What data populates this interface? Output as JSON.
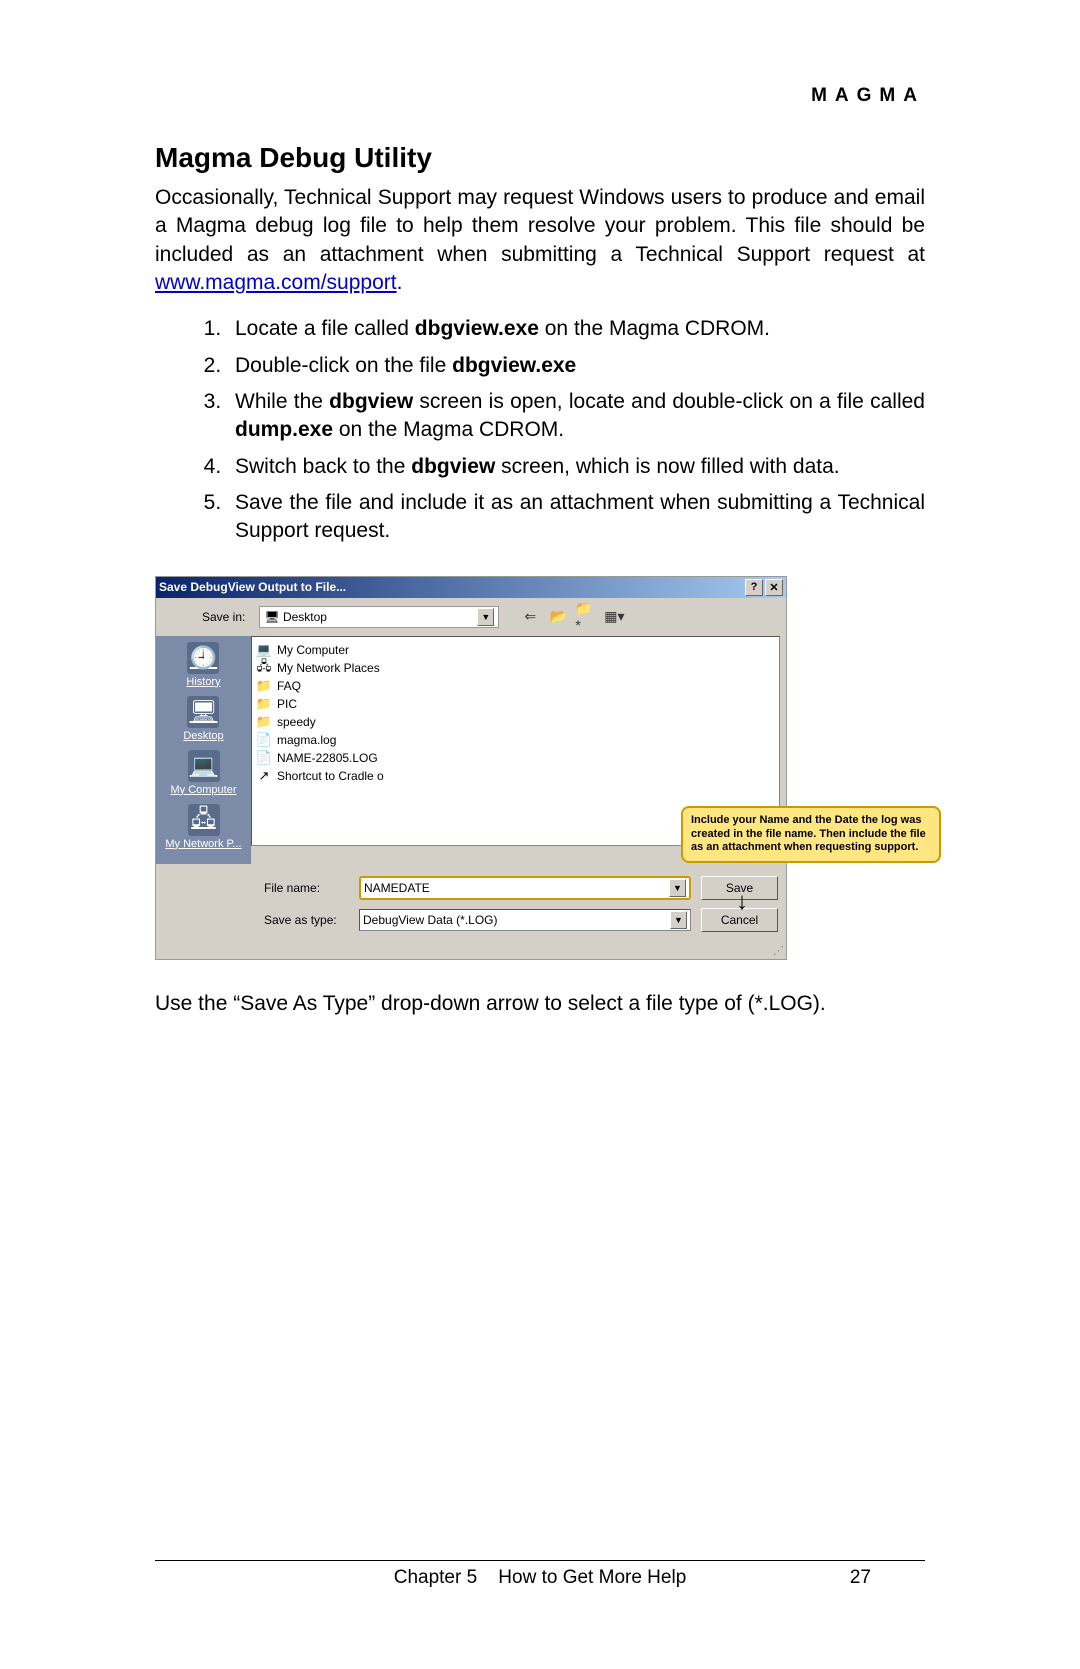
{
  "header": {
    "brand": "MAGMA"
  },
  "title": "Magma Debug Utility",
  "intro": {
    "part1": "Occasionally, Technical Support may request Windows users to produce and email a Magma debug log file to help them resolve your problem.  This file should be included as an attachment when submitting a Technical Support request at",
    "link": "www.magma.com/support",
    "part2": "."
  },
  "steps": [
    {
      "a": "Locate a file called",
      "b": "dbgview.exe",
      "c": "on the Magma CDROM."
    },
    {
      "a": "Double-click on the file",
      "b": "dbgview.exe"
    },
    {
      "a": "While the",
      "b": "dbgview",
      "c": "screen is open, locate and double-click on a file called",
      "d": "dump.exe",
      "e": "on the Magma CDROM."
    },
    {
      "a": "Switch back to the",
      "b": "dbgview",
      "c": "screen, which is now filled with data."
    },
    {
      "a": "Save the file and include it as an attachment when submitting a Technical Support request."
    }
  ],
  "dialog": {
    "title": "Save DebugView Output to File...",
    "help_btn": "?",
    "close_btn": "✕",
    "save_in_label": "Save in:",
    "save_in_value": "Desktop",
    "sidebar": [
      "History",
      "Desktop",
      "My Computer",
      "My Network P..."
    ],
    "files": [
      "My Computer",
      "My Network Places",
      "FAQ",
      "PIC",
      "speedy",
      "magma.log",
      "NAME-22805.LOG",
      "Shortcut to Cradle o"
    ],
    "callout": "Include your Name and the Date the log was created in the file name. Then include the file as an attachment when requesting support.",
    "filename_label": "File name:",
    "filename_value": "NAMEDATE",
    "savetype_label": "Save as type:",
    "savetype_value": "DebugView Data (*.LOG)",
    "save_btn": "Save",
    "cancel_btn": "Cancel"
  },
  "closing": "Use the “Save As Type” drop-down arrow to select a file type of (*.LOG).",
  "footer": {
    "chapter": "Chapter 5",
    "section": "How to Get More Help",
    "page": "27"
  }
}
